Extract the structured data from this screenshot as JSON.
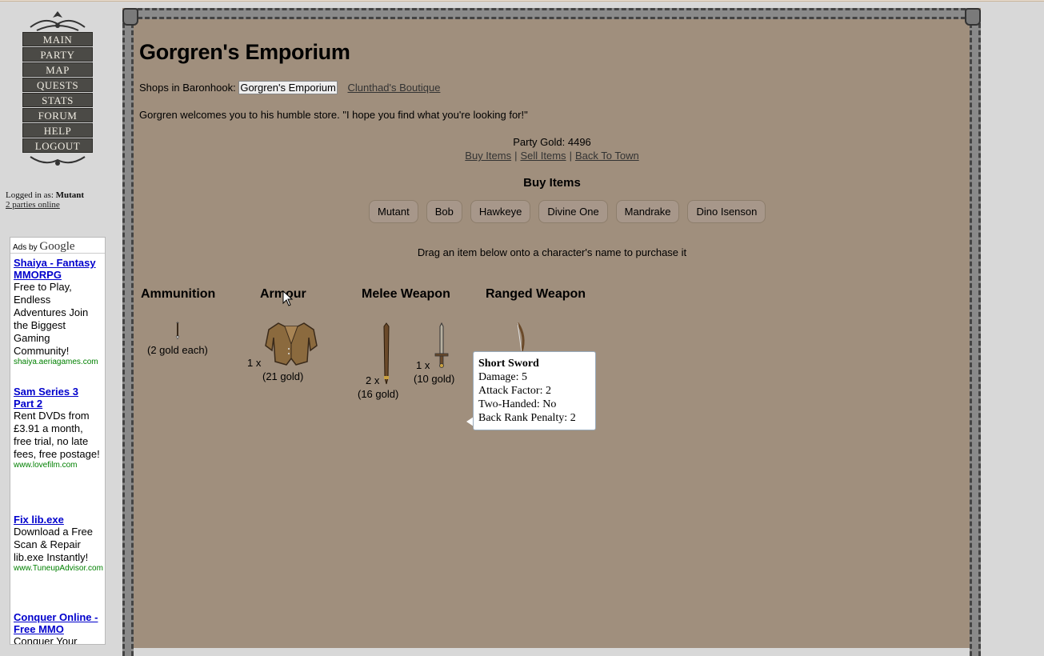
{
  "nav": {
    "items": [
      "MAIN",
      "PARTY",
      "MAP",
      "QUESTS",
      "STATS",
      "FORUM",
      "HELP",
      "LOGOUT"
    ]
  },
  "login": {
    "prefix": "Logged in as:",
    "user": "Mutant",
    "online": "2 parties online"
  },
  "ads": {
    "header_prefix": "Ads by",
    "header_brand": "Google",
    "items": [
      {
        "title": "Shaiya - Fantasy MMORPG",
        "desc": "Free to Play, Endless Adventures Join the Biggest Gaming Community!",
        "url": "shaiya.aeriagames.com"
      },
      {
        "title": "Sam Series 3 Part 2",
        "desc": "Rent DVDs from £3.91 a month, free trial, no late fees, free postage!",
        "url": "www.lovefilm.com"
      },
      {
        "title": "Fix lib.exe",
        "desc": "Download a Free Scan & Repair lib.exe Instantly!",
        "url": "www.TuneupAdvisor.com"
      },
      {
        "title": "Conquer Online - Free MMO",
        "desc": "Conquer Your",
        "url": ""
      }
    ]
  },
  "main": {
    "title": "Gorgren's Emporium",
    "shops_label": "Shops in Baronhook:",
    "shops": [
      "Gorgren's Emporium",
      "Clunthad's Boutique"
    ],
    "welcome": "Gorgren welcomes you to his humble store. \"I hope you find what you're looking for!\"",
    "party_gold": "Party Gold: 4496",
    "links": [
      "Buy Items",
      "Sell Items",
      "Back To Town"
    ],
    "buy_heading": "Buy Items",
    "characters": [
      "Mutant",
      "Bob",
      "Hawkeye",
      "Divine One",
      "Mandrake",
      "Dino Isenson"
    ],
    "drag_note": "Drag an item below onto a character's name to purchase it",
    "categories": [
      "Ammunition",
      "Armour",
      "Melee Weapon",
      "Ranged Weapon"
    ],
    "items": {
      "ammo_price": "(2 gold each)",
      "armour_qty": "1 x",
      "armour_price": "(21 gold)",
      "staff_qty": "2 x",
      "staff_price": "(16 gold)",
      "sword_qty": "1 x",
      "sword_price": "(10 gold)"
    }
  },
  "tooltip": {
    "name": "Short Sword",
    "lines": [
      "Damage: 5",
      "Attack Factor: 2",
      "Two-Handed: No",
      "Back Rank Penalty: 2"
    ]
  },
  "colors": {
    "panel_bg": "#a08f7d",
    "nav_bg": "#4b4a46",
    "ad_title": "#0000cc",
    "ad_url": "#008000"
  }
}
